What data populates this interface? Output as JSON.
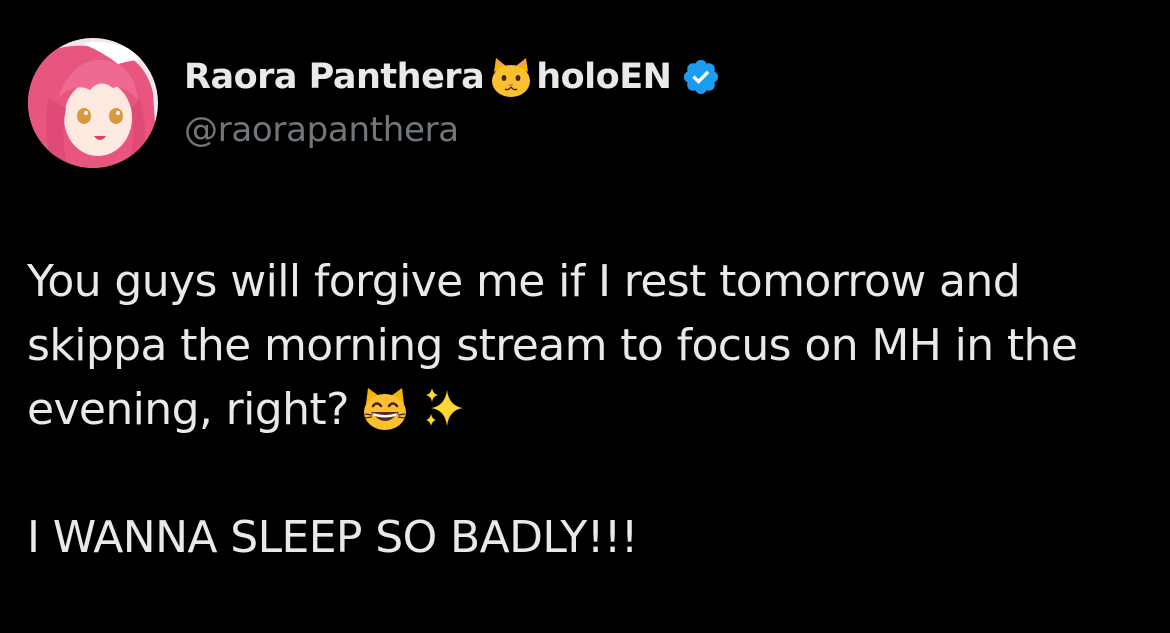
{
  "tweet": {
    "author": {
      "display_name": "Raora Panthera",
      "name_emoji": "cat-face-icon",
      "affiliation": "holoEN",
      "verified": true,
      "handle": "@raorapanthera"
    },
    "text": {
      "line1": "You guys will forgive me if I rest tomorrow and",
      "line2": "skippa the morning stream to focus on MH in the",
      "line3": "evening, right?",
      "line3_emojis": [
        "grinning-cat-icon",
        "sparkles-icon"
      ],
      "line4": "I WANNA SLEEP SO BADLY!!!"
    }
  },
  "colors": {
    "background": "#000000",
    "text_primary": "#e7e9ea",
    "text_secondary": "#71767b",
    "verified_blue": "#1d9bf0"
  }
}
